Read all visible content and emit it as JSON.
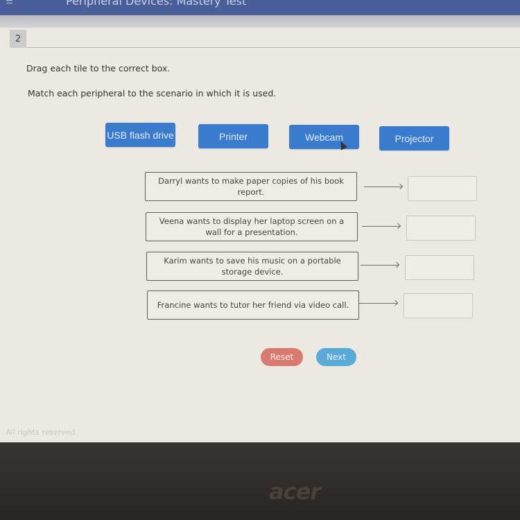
{
  "header": {
    "title": "Peripheral Devices: Mastery Test"
  },
  "question": {
    "number": "2",
    "instruction": "Drag each tile to the correct box.",
    "prompt": "Match each peripheral to the scenario in which it is used."
  },
  "tiles": [
    {
      "label": "USB flash drive"
    },
    {
      "label": "Printer"
    },
    {
      "label": "Webcam"
    },
    {
      "label": "Projector"
    }
  ],
  "scenarios": [
    {
      "text": "Darryl wants to make paper copies of his book report.",
      "answer": ""
    },
    {
      "text": "Veena wants to display her laptop screen on a wall for a presentation.",
      "answer": ""
    },
    {
      "text": "Karim wants to save his music on a portable storage device.",
      "answer": ""
    },
    {
      "text": "Francine wants to tutor her friend via video call.",
      "answer": ""
    }
  ],
  "buttons": {
    "reset": "Reset",
    "next": "Next"
  },
  "footer": {
    "text": "All rights reserved."
  },
  "device": {
    "brand": "acer"
  },
  "colors": {
    "tile": "#3a7bcd",
    "reset": "#d97a70",
    "next": "#5aaad8",
    "header": "#4a5e9a"
  }
}
